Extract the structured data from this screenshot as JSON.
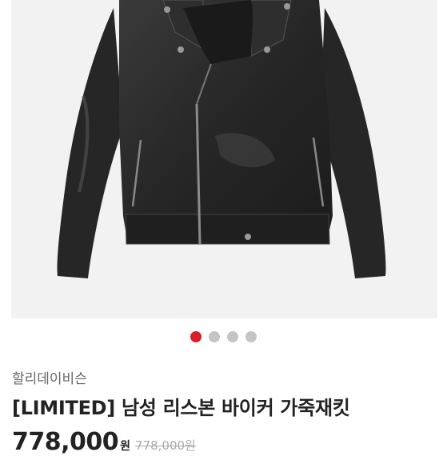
{
  "product": {
    "image_icon": "leather-jacket-photo",
    "carousel": {
      "total": 4,
      "active_index": 0,
      "active_color": "#d61f26",
      "inactive_color": "#c4c4c4"
    },
    "brand": "할리데이비슨",
    "title": "[LIMITED] 남성 리스본 바이커 가죽재킷",
    "price": "778,000",
    "price_unit": "원",
    "original_price": "778,000원"
  }
}
